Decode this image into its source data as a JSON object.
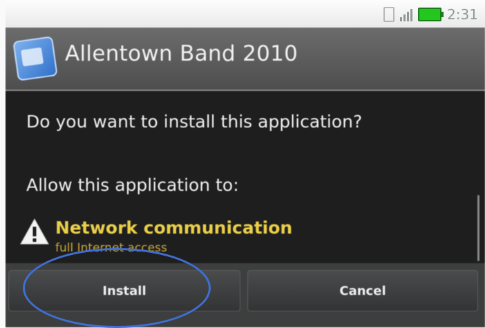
{
  "status_bar": {
    "time": "2:31",
    "icons": [
      "sim-icon",
      "signal-icon",
      "battery-icon"
    ]
  },
  "dialog": {
    "title": "Allentown Band 2010",
    "question": "Do you want to install this application?",
    "allow_heading": "Allow this application to:",
    "permissions": [
      {
        "icon": "warning-icon",
        "title": "Network communication",
        "subtitle": "full Internet access"
      }
    ],
    "buttons": {
      "install_label": "Install",
      "cancel_label": "Cancel"
    }
  },
  "annotation": {
    "color": "#3f6fd4",
    "target": "install-button"
  }
}
